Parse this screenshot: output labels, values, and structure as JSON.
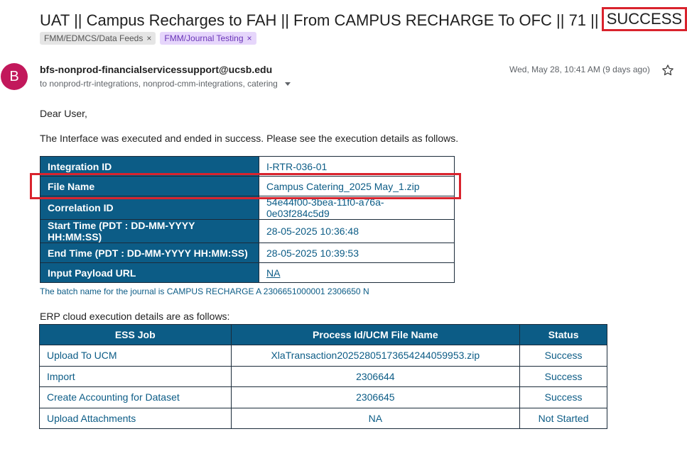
{
  "email": {
    "subject_main": "UAT || Campus Recharges to FAH || From CAMPUS RECHARGE To OFC || 71 ||",
    "subject_status": "SUCCESS",
    "labels": [
      {
        "text": "FMM/EDMCS/Data Feeds",
        "close": "×"
      },
      {
        "text": "FMM/Journal Testing",
        "close": "×"
      }
    ],
    "avatar_letter": "B",
    "sender": "bfs-nonprod-financialservicessupport@ucsb.edu",
    "recipients": "to nonprod-rtr-integrations, nonprod-cmm-integrations, catering",
    "date": "Wed, May 28, 10:41 AM (9 days ago)",
    "greeting": "Dear User,",
    "intro": "The Interface was executed and ended in success. Please see the execution details as follows.",
    "details": [
      {
        "key": "Integration ID",
        "value": "I-RTR-036-01"
      },
      {
        "key": "File Name",
        "value": "Campus Catering_2025 May_1.zip"
      },
      {
        "key": "Correlation ID",
        "value": "54e44f00-3bea-11f0-a76a-0e03f284c5d9"
      },
      {
        "key": "Start Time (PDT : DD-MM-YYYY HH:MM:SS)",
        "value": "28-05-2025 10:36:48"
      },
      {
        "key": "End Time (PDT : DD-MM-YYYY HH:MM:SS)",
        "value": "28-05-2025 10:39:53"
      },
      {
        "key": "Input Payload URL",
        "value": "NA"
      }
    ],
    "batch_text": "The batch name for the journal is CAMPUS RECHARGE A 2306651000001 2306650 N",
    "erp_intro": "ERP cloud execution details are as follows:",
    "erp_headers": [
      "ESS Job",
      "Process Id/UCM File Name",
      "Status"
    ],
    "erp_rows": [
      {
        "job": "Upload To UCM",
        "process": "XlaTransaction20252805173654244059953.zip",
        "status": "Success"
      },
      {
        "job": "Import",
        "process": "2306644",
        "status": "Success"
      },
      {
        "job": "Create Accounting for Dataset",
        "process": "2306645",
        "status": "Success"
      },
      {
        "job": "Upload Attachments",
        "process": "NA",
        "status": "Not Started"
      }
    ]
  },
  "colors": {
    "header_blue": "#0c5c86",
    "highlight_red": "#d9232d",
    "avatar": "#c2185b"
  }
}
